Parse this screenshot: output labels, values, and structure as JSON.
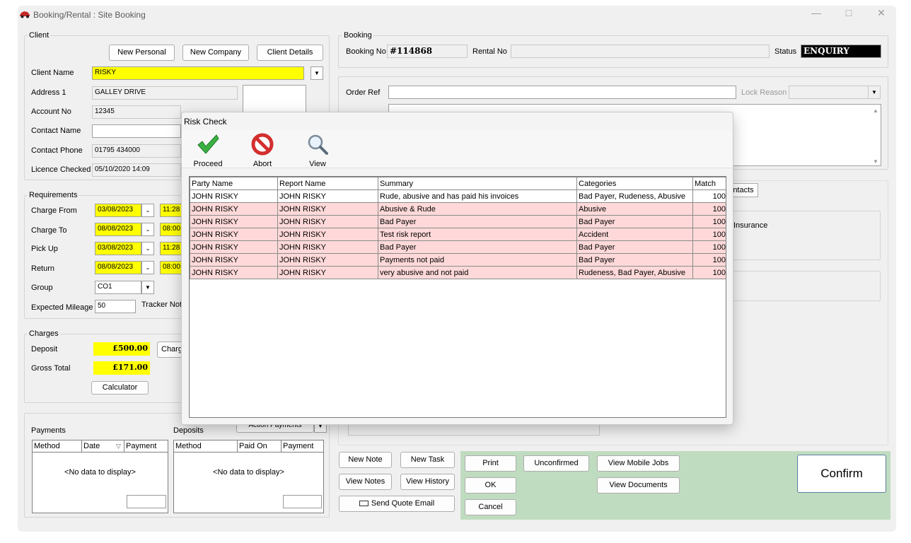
{
  "window": {
    "title": "Booking/Rental : Site Booking"
  },
  "client": {
    "group_label": "Client",
    "new_personal": "New Personal",
    "new_company": "New Company",
    "client_details": "Client Details",
    "client_name_label": "Client Name",
    "client_name": "RISKY",
    "address1_label": "Address 1",
    "address1": "GALLEY DRIVE",
    "account_no_label": "Account No",
    "account_no": "12345",
    "contact_name_label": "Contact Name",
    "contact_name": "",
    "contact_phone_label": "Contact Phone",
    "contact_phone": "01795 434000",
    "licence_checked_label": "Licence Checked",
    "licence_checked": "05/10/2020 14:09"
  },
  "booking": {
    "group_label": "Booking",
    "booking_no_label": "Booking No",
    "booking_no": "#114868",
    "rental_no_label": "Rental No",
    "rental_no": "",
    "status_label": "Status",
    "status": "ENQUIRY",
    "order_ref_label": "Order Ref",
    "order_ref": "",
    "lock_reason_label": "Lock Reason",
    "lock_reason": ""
  },
  "requirements": {
    "group_label": "Requirements",
    "charge_from_label": "Charge From",
    "charge_from_date": "03/08/2023",
    "charge_from_time": "11:28",
    "charge_to_label": "Charge To",
    "charge_to_date": "08/08/2023",
    "charge_to_time": "08:00",
    "pick_up_label": "Pick Up",
    "pick_up_date": "03/08/2023",
    "pick_up_time": "11:28",
    "return_label": "Return",
    "return_date": "08/08/2023",
    "return_time": "08:00",
    "group_field_label": "Group",
    "group_value": "CO1",
    "expected_mileage_label": "Expected Mileage",
    "expected_mileage": "50",
    "tracker_label": "Tracker Not"
  },
  "charges": {
    "group_label": "Charges",
    "deposit_label": "Deposit",
    "deposit": "£500.00",
    "charge_btn": "Charg",
    "gross_total_label": "Gross Total",
    "gross_total": "£171.00",
    "calculator": "Calculator"
  },
  "payments": {
    "label": "Payments",
    "columns": [
      "Method",
      "Date",
      "Payment"
    ],
    "no_data": "<No data to display>",
    "action_payments": "Action Payments"
  },
  "deposits": {
    "label": "Deposits",
    "columns": [
      "Method",
      "Paid On",
      "Payment"
    ],
    "no_data": "<No data to display>"
  },
  "side_tabs": {
    "contacts_partial": "ntacts",
    "insurance_partial": "Insurance"
  },
  "actions": {
    "new_note": "New Note",
    "new_task": "New Task",
    "view_notes": "View Notes",
    "view_history": "View History",
    "send_quote_email": "Send Quote Email",
    "print": "Print",
    "unconfirmed": "Unconfirmed",
    "view_mobile_jobs": "View Mobile Jobs",
    "ok": "OK",
    "view_documents": "View Documents",
    "cancel": "Cancel",
    "confirm": "Confirm"
  },
  "risk_check": {
    "title": "Risk Check",
    "proceed": "Proceed",
    "abort": "Abort",
    "view": "View",
    "columns": [
      "Party Name",
      "Report Name",
      "Summary",
      "Categories",
      "Match"
    ],
    "rows": [
      {
        "party": "JOHN RISKY",
        "report": "JOHN RISKY",
        "summary": "Rude, abusive and has paid his invoices",
        "categories": "Bad Payer, Rudeness, Abusive",
        "match": "100",
        "highlight": false
      },
      {
        "party": "JOHN RISKY",
        "report": "JOHN RISKY",
        "summary": "Abusive & Rude",
        "categories": "Abusive",
        "match": "100",
        "highlight": true
      },
      {
        "party": "JOHN RISKY",
        "report": "JOHN RISKY",
        "summary": "Bad Payer",
        "categories": "Bad Payer",
        "match": "100",
        "highlight": true
      },
      {
        "party": "JOHN RISKY",
        "report": "JOHN RISKY",
        "summary": "Test risk report",
        "categories": "Accident",
        "match": "100",
        "highlight": true
      },
      {
        "party": "JOHN RISKY",
        "report": "JOHN RISKY",
        "summary": "Bad Payer",
        "categories": "Bad Payer",
        "match": "100",
        "highlight": true
      },
      {
        "party": "JOHN RISKY",
        "report": "JOHN RISKY",
        "summary": "Payments not paid",
        "categories": "Bad Payer",
        "match": "100",
        "highlight": true
      },
      {
        "party": "JOHN RISKY",
        "report": "JOHN RISKY",
        "summary": "very abusive and not paid",
        "categories": "Rudeness, Bad Payer, Abusive",
        "match": "100",
        "highlight": true
      }
    ]
  },
  "colors": {
    "highlight_yellow": "#ffff00",
    "risk_row_pink": "#ffd9d9",
    "action_panel_green": "#c0dcc0",
    "proceed_green": "#3cb043",
    "abort_red": "#d32f2f"
  }
}
